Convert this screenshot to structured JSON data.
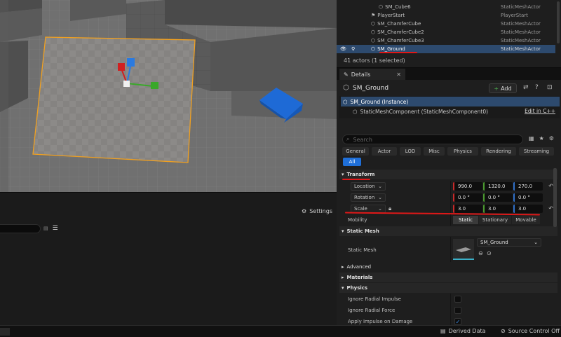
{
  "outliner": {
    "rows": [
      {
        "name": "SM_Cube6",
        "type": "StaticMeshActor"
      },
      {
        "name": "PlayerStart",
        "type": "PlayerStart"
      },
      {
        "name": "SM_ChamferCube",
        "type": "StaticMeshActor"
      },
      {
        "name": "SM_ChamferCube2",
        "type": "StaticMeshActor"
      },
      {
        "name": "SM_ChamferCube3",
        "type": "StaticMeshActor"
      },
      {
        "name": "SM_Ground",
        "type": "StaticMeshActor"
      }
    ],
    "count_text": "41 actors (1 selected)"
  },
  "details": {
    "tab_label": "Details",
    "object_name": "SM_Ground",
    "add_label": "Add",
    "components": {
      "root": "SM_Ground (Instance)",
      "child": "StaticMeshComponent (StaticMeshComponent0)",
      "edit_link": "Edit in C++"
    },
    "search_placeholder": "Search",
    "categories": [
      "General",
      "Actor",
      "LOD",
      "Misc",
      "Physics",
      "Rendering",
      "Streaming"
    ],
    "all_label": "All",
    "transform": {
      "section_label": "Transform",
      "location": {
        "label": "Location",
        "x": "990.0",
        "y": "1320.0",
        "z": "270.0"
      },
      "rotation": {
        "label": "Rotation",
        "x": "0.0 °",
        "y": "0.0 °",
        "z": "0.0 °"
      },
      "scale": {
        "label": "Scale",
        "x": "3.0",
        "y": "3.0",
        "z": "3.0"
      },
      "mobility_label": "Mobility",
      "mobility_options": [
        "Static",
        "Stationary",
        "Movable"
      ]
    },
    "static_mesh": {
      "section_label": "Static Mesh",
      "prop_label": "Static Mesh",
      "asset": "SM_Ground"
    },
    "advanced_label": "Advanced",
    "materials_label": "Materials",
    "physics": {
      "section_label": "Physics",
      "props": [
        "Ignore Radial Impulse",
        "Ignore Radial Force",
        "Apply Impulse on Damage"
      ]
    }
  },
  "lower_panel": {
    "settings_label": "Settings"
  },
  "statusbar": {
    "derived_data": "Derived Data",
    "source_control": "Source Control Off"
  },
  "colors": {
    "selection": "#2d4a6e",
    "accent_blue": "#1f6fd8",
    "annotation_red": "#e01818",
    "ground_outline": "#f0a020"
  }
}
